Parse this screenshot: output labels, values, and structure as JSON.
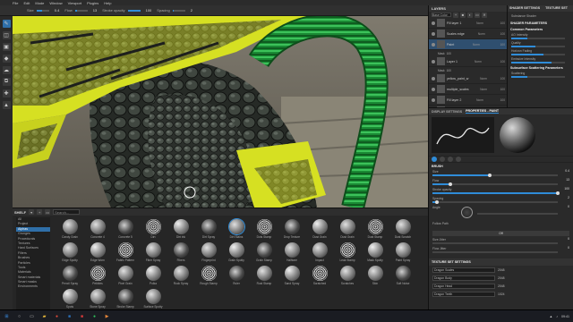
{
  "app": {
    "menu": [
      "File",
      "Edit",
      "Mode",
      "Window",
      "Viewport",
      "Plugins",
      "Help"
    ]
  },
  "tool_options": {
    "size_label": "Size",
    "size_value": "0.4",
    "flow_label": "Flow",
    "flow_value": "13",
    "stroke_opacity_label": "Stroke opacity",
    "stroke_opacity_value": "100",
    "spacing_label": "Spacing",
    "spacing_value": "2"
  },
  "tools": [
    "paint-brush-icon",
    "eraser-icon",
    "projection-icon",
    "geometry-mask-icon",
    "smudge-icon",
    "clone-icon",
    "color-picker-icon",
    "polygon-fill-icon"
  ],
  "shelf": {
    "title": "SHELF",
    "search_placeholder": "Search...",
    "categories": [
      "All",
      "Project",
      "Alphas",
      "Grunges",
      "Procedurals",
      "Textures",
      "Hard Surfaces",
      "Filters",
      "Brushes",
      "Particles",
      "Tools",
      "Materials",
      "Smart materials",
      "Smart masks",
      "Environments"
    ],
    "selected_category_index": 2,
    "brushes": [
      "Candy Grain",
      "Concrete 4",
      "Concrete 5",
      "Dirt",
      "Dirt Ink",
      "Dirt Spray",
      "Dirt Stains",
      "Dots Stamp",
      "Drop Texture",
      "Dust Grain",
      "Dust Grain",
      "Dust Stamp",
      "Dust Scratch",
      "Edge Spotty",
      "Edge Worn",
      "Fabric Pattern",
      "Fiber Spray",
      "Fibers",
      "Fingerprint",
      "Grain Spotty",
      "Grain Stamp",
      "Halftone",
      "Impact",
      "Leak Stamp",
      "Mask Spotty",
      "Paint Spray",
      "Pencil Spray",
      "Pebbles",
      "Pixel Grain",
      "Polka",
      "Rock Spray",
      "Rough Stamp",
      "Ruler",
      "Rust Stamp",
      "Sand Spray",
      "Scratched",
      "Scratches",
      "Skin",
      "Soft Noise",
      "Spots",
      "Stone Spray",
      "Stroke Stamp",
      "Surface Spotty"
    ],
    "selected_brush_index": 6
  },
  "layers": {
    "title": "LAYERS",
    "blend_mode": "Base Color",
    "items": [
      {
        "name": "Fill layer 1",
        "mode": "Norm",
        "value": "100"
      },
      {
        "name": "Scales edge",
        "mode": "Norm",
        "value": "100"
      },
      {
        "name": "Paint",
        "mode": "Norm",
        "value": "100"
      },
      {
        "name": "Layer 1",
        "mode": "Norm",
        "value": "100"
      },
      {
        "name": "yellow_paint_w",
        "mode": "Norm",
        "value": "100"
      },
      {
        "name": "multiple_scales",
        "mode": "Norm",
        "value": "100"
      },
      {
        "name": "Fill layer 2",
        "mode": "Norm",
        "value": "100"
      },
      {
        "name": "dragon_base_scales",
        "mode": "Norm",
        "value": "100"
      }
    ],
    "sub_rows": [
      {
        "label": "Mask",
        "value": "100"
      },
      {
        "label": "Mask",
        "value": "100"
      }
    ]
  },
  "shader": {
    "tabs": [
      "SHADER SETTINGS",
      "TEXTURE SET"
    ],
    "sub_label": "Substance Shader",
    "title": "SHADER PARAMETERS",
    "sections": [
      {
        "title": "Common Parameters",
        "rows": [
          "AO Intensity",
          "Quality",
          "Horizon Fading",
          "Emissive Intensity"
        ]
      },
      {
        "title": "Subsurface Scattering Parameters",
        "rows": [
          "Scattering"
        ]
      }
    ]
  },
  "props": {
    "tabs": [
      "DISPLAY SETTINGS",
      "PROPERTIES - PAINT"
    ],
    "active_tab_index": 1,
    "section": "BRUSH",
    "fields": [
      {
        "label": "Size",
        "value": "0.4",
        "fill": 0.45
      },
      {
        "label": "Flow",
        "value": "13",
        "fill": 0.13
      },
      {
        "label": "Stroke opacity",
        "value": "100",
        "fill": 1.0
      },
      {
        "label": "Spacing",
        "value": "2",
        "fill": 0.02
      }
    ],
    "angle_label": "Angle",
    "angle_value": "0",
    "follow_path_label": "Follow Path",
    "follow_path_value": "Off",
    "size_jitter_label": "Size Jitter",
    "size_jitter_value": "0",
    "flow_jitter_label": "Flow Jitter",
    "flow_jitter_value": "0",
    "texture_set_title": "TEXTURE SET SETTINGS",
    "texture_rows": [
      {
        "label": "Dragon Scales",
        "value": "2048"
      },
      {
        "label": "Dragon Body",
        "value": "2048"
      },
      {
        "label": "Dragon Head",
        "value": "2048"
      },
      {
        "label": "Dragon Teeth",
        "value": "1024"
      }
    ]
  },
  "taskbar": {
    "items": [
      "windows-start-icon",
      "search-icon",
      "task-view-icon",
      "explorer-icon",
      "chrome-icon",
      "photoshop-icon",
      "substance-painter-icon",
      "spotify-icon",
      "media-player-icon"
    ],
    "clock": "09:41"
  },
  "colors": {
    "accent": "#2f8cd8",
    "paint_yellow": "#d6e022",
    "hose_green": "#1f9a3a"
  }
}
